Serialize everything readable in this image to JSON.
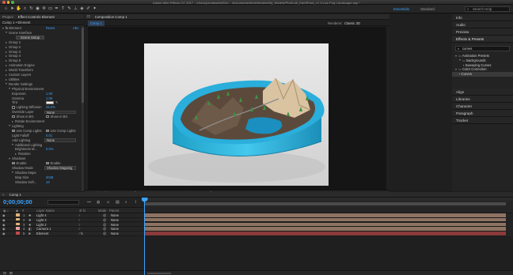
{
  "app": {
    "title": "Adobe After Effects CC 2017 - /Users/jonnasselat/Dev... /documents/Work/Models/My_Models/PixelLab_EarthPack_v1.1/Low Poly Landscape.aep *"
  },
  "toolbar": {
    "workspaces": [
      "Essentials",
      "Standard"
    ],
    "active_workspace": "Essentials",
    "search_placeholder": "Search Help"
  },
  "left_panel": {
    "tabs": [
      "Project",
      "Effect Controls Element"
    ],
    "subheader": "Comp 1 • Element",
    "rows": [
      {
        "label": "Element",
        "value": "Reset",
        "extra": "Abo",
        "level": 0,
        "type": "fx"
      },
      {
        "label": "Scene Interface",
        "level": 1,
        "type": "open"
      },
      {
        "label": "Scene Setup",
        "level": 2,
        "type": "button"
      },
      {
        "label": "Group 1",
        "level": 1,
        "type": "closed"
      },
      {
        "label": "Group 2",
        "level": 1,
        "type": "closed"
      },
      {
        "label": "Group 3",
        "level": 1,
        "type": "closed"
      },
      {
        "label": "Group 4",
        "level": 1,
        "type": "closed"
      },
      {
        "label": "Group 5",
        "level": 1,
        "type": "closed"
      },
      {
        "label": "Animation Engine",
        "level": 1,
        "type": "closed"
      },
      {
        "label": "World Transform",
        "level": 1,
        "type": "closed"
      },
      {
        "label": "Custom Layers",
        "level": 1,
        "type": "closed"
      },
      {
        "label": "Utilities",
        "level": 1,
        "type": "closed"
      },
      {
        "label": "Render Settings",
        "level": 1,
        "type": "open"
      },
      {
        "label": "Physical Environment",
        "level": 2,
        "type": "open"
      },
      {
        "label": "Exposure",
        "value": "1.00",
        "level": 3,
        "type": "value"
      },
      {
        "label": "Gamma",
        "value": "1.00",
        "level": 3,
        "type": "value"
      },
      {
        "label": "Tint",
        "level": 3,
        "type": "swatch"
      },
      {
        "label": "Lighting Diffusion",
        "value": "25.0%",
        "level": 3,
        "type": "check-value"
      },
      {
        "label": "Override Layer",
        "value": "None",
        "level": 3,
        "type": "dropdown"
      },
      {
        "label": "Show in BG",
        "extra": "Show in BG",
        "level": 3,
        "type": "double-check"
      },
      {
        "label": "Rotate Environment",
        "level": 3,
        "type": "closed"
      },
      {
        "label": "Lighting",
        "level": 2,
        "type": "open"
      },
      {
        "label": "Use Comp Lights",
        "extra": "Use Comp Lights",
        "level": 3,
        "type": "double-check-on"
      },
      {
        "label": "Light Falloff",
        "value": "0.01",
        "level": 3,
        "type": "value"
      },
      {
        "label": "Add Lighting",
        "value": "None",
        "level": 3,
        "type": "dropdown"
      },
      {
        "label": "Additional Lighting",
        "level": 3,
        "type": "open"
      },
      {
        "label": "Brightness M...",
        "value": "0.0%",
        "level": 4,
        "type": "value"
      },
      {
        "label": "Rotation",
        "level": 4,
        "type": "closed"
      },
      {
        "label": "Shadows",
        "level": 2,
        "type": "open"
      },
      {
        "label": "Enable",
        "extra": "Enable",
        "level": 3,
        "type": "double-check-on"
      },
      {
        "label": "Shadow Mode",
        "value": "Shadow Mapping",
        "level": 3,
        "type": "dropdown"
      },
      {
        "label": "Shadow Maps",
        "level": 3,
        "type": "open"
      },
      {
        "label": "Map Size",
        "value": "2048",
        "level": 4,
        "type": "value"
      },
      {
        "label": "Shadow Soft...",
        "value": "16",
        "level": 4,
        "type": "value"
      }
    ]
  },
  "viewer": {
    "tab": "Composition Comp 1",
    "comp_tab": "Comp 1",
    "renderer_label": "Renderer:",
    "renderer_value": "Classic 3D",
    "bottom_bar": [
      "(50%)",
      "Full",
      "Camera 1",
      "1 View",
      "+0.0"
    ]
  },
  "right_panel": {
    "sections_top": [
      "Info",
      "Audio",
      "Preview"
    ],
    "effects_title": "Effects & Presets",
    "search_value": "curves",
    "tree": [
      {
        "label": "Animation Presets",
        "level": 0,
        "open": true
      },
      {
        "label": "Backgrounds",
        "level": 1,
        "open": true
      },
      {
        "label": "Sweeping Curves",
        "level": 2,
        "leaf": true
      },
      {
        "label": "Color Correction",
        "level": 0,
        "open": true
      },
      {
        "label": "Curves",
        "level": 1,
        "leaf": true,
        "selected": true
      }
    ],
    "sections_bottom": [
      "Align",
      "Libraries",
      "Character",
      "Paragraph",
      "Tracker"
    ]
  },
  "timeline": {
    "tab": "Comp 1",
    "timecode": "0;00;00;00",
    "col_headers": [
      "#",
      "Layer Name",
      "Mode",
      "Parent"
    ],
    "layers": [
      {
        "num": "1",
        "name": "Light 4",
        "parent": "None",
        "color": "#e0b47a"
      },
      {
        "num": "2",
        "name": "Light 3",
        "parent": "None",
        "color": "#e0b47a"
      },
      {
        "num": "3",
        "name": "Light 2",
        "parent": "None",
        "color": "#e0b47a"
      },
      {
        "num": "4",
        "name": "Camera 1",
        "parent": "None",
        "color": "#e6a0a0"
      },
      {
        "num": "5",
        "name": "Element",
        "parent": "None",
        "color": "#c24a4a"
      }
    ],
    "ruler_labels": [
      "0:00s",
      "02s",
      "04s",
      "06s",
      "08s",
      "10s",
      "12s",
      "14s",
      "16s",
      "18s",
      "20s",
      "22s",
      "24s",
      "26s",
      "28s"
    ]
  }
}
